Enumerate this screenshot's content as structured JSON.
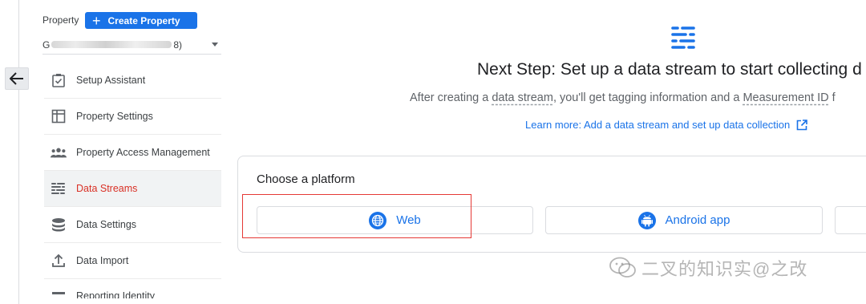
{
  "property": {
    "label": "Property",
    "create_label": "Create Property",
    "selector_prefix": "G",
    "selector_suffix": "8)"
  },
  "nav": {
    "items": [
      {
        "label": "Setup Assistant",
        "icon": "checklist-icon"
      },
      {
        "label": "Property Settings",
        "icon": "settings-panel-icon"
      },
      {
        "label": "Property Access Management",
        "icon": "people-icon"
      },
      {
        "label": "Data Streams",
        "icon": "data-streams-icon",
        "active": true
      },
      {
        "label": "Data Settings",
        "icon": "database-icon"
      },
      {
        "label": "Data Import",
        "icon": "upload-icon"
      },
      {
        "label": "Reporting Identity",
        "icon": "reporting-identity-icon"
      }
    ]
  },
  "main": {
    "heading": "Next Step: Set up a data stream to start collecting d",
    "sub_before": "After creating a ",
    "sub_link1": "data stream",
    "sub_middle": ", you'll get tagging information and a ",
    "sub_link2": "Measurement ID",
    "sub_after": " f",
    "learn_more": "Learn more: Add a data stream and set up data collection"
  },
  "platforms": {
    "title": "Choose a platform",
    "buttons": [
      {
        "label": "Web",
        "icon": "globe-icon"
      },
      {
        "label": "Android app",
        "icon": "android-icon"
      },
      {
        "label": "",
        "icon": ""
      }
    ]
  },
  "colors": {
    "accent": "#1a73e8",
    "active_nav": "#d93025",
    "highlight_box": "#e53935"
  },
  "watermark": "二叉的知识实@之改"
}
